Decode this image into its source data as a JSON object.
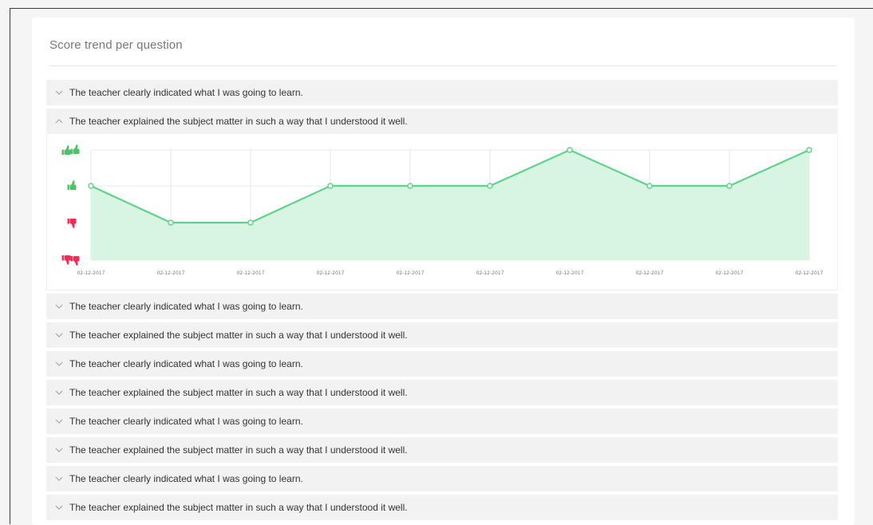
{
  "panel": {
    "title": "Score trend per question"
  },
  "questions": [
    {
      "label": "The teacher clearly indicated what I was going to learn.",
      "expanded": false
    },
    {
      "label": "The teacher explained the subject matter in such a way that I understood it well.",
      "expanded": true
    },
    {
      "label": "The teacher clearly indicated what I was going to learn.",
      "expanded": false
    },
    {
      "label": "The teacher explained the subject matter in such a way that I understood it well.",
      "expanded": false
    },
    {
      "label": "The teacher clearly indicated what I was going to learn.",
      "expanded": false
    },
    {
      "label": "The teacher explained the subject matter in such a way that I understood it well.",
      "expanded": false
    },
    {
      "label": "The teacher clearly indicated what I was going to learn.",
      "expanded": false
    },
    {
      "label": "The teacher explained the subject matter in such a way that I understood it well.",
      "expanded": false
    },
    {
      "label": "The teacher clearly indicated what I was going to learn.",
      "expanded": false
    },
    {
      "label": "The teacher explained the subject matter in such a way that I understood it well.",
      "expanded": false
    }
  ],
  "chart_data": {
    "type": "area",
    "x": [
      "02-12-2017",
      "02-12-2017",
      "02-12-2017",
      "02-12-2017",
      "02-12-2017",
      "02-12-2017",
      "02-12-2017",
      "02-12-2017",
      "02-12-2017",
      "02-12-2017"
    ],
    "series": [
      {
        "values": [
          3,
          2,
          2,
          3,
          3,
          3,
          4,
          3,
          3,
          4
        ]
      }
    ],
    "y_levels": [
      {
        "value": 4,
        "icon": "double-thumbs-up-icon"
      },
      {
        "value": 3,
        "icon": "thumbs-up-icon"
      },
      {
        "value": 2,
        "icon": "thumbs-down-icon"
      },
      {
        "value": 1,
        "icon": "double-thumbs-down-icon"
      }
    ],
    "ylim": [
      1,
      4
    ],
    "grid": true,
    "colors": {
      "line": "#5fd38a",
      "fill": "#d8f4e2",
      "positive": "#52c16b",
      "negative": "#ef2d56"
    }
  }
}
